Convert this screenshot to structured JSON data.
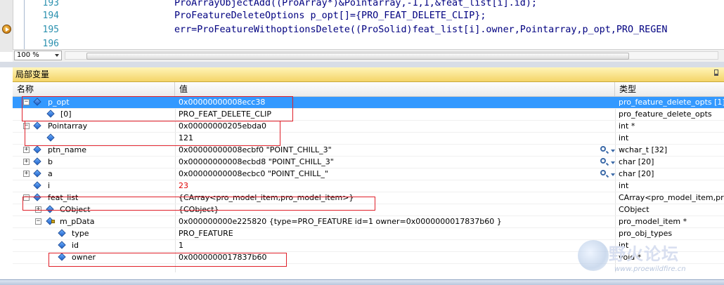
{
  "editor": {
    "lines": [
      {
        "num": "193",
        "code": "ProArrayObjectAdd((ProArray*)&Pointarray,-1,1,&feat_list[i].id);"
      },
      {
        "num": "194",
        "code": "ProFeatureDeleteOptions p_opt[]={PRO_FEAT_DELETE_CLIP};"
      },
      {
        "num": "195",
        "code": "err=ProFeatureWithoptionsDelete((ProSolid)feat_list[i].owner,Pointarray,p_opt,PRO_REGEN"
      },
      {
        "num": "196",
        "code": ""
      }
    ],
    "zoom": "100 %"
  },
  "locals": {
    "title": "局部变量",
    "columns": {
      "name": "名称",
      "value": "值",
      "type": "类型"
    },
    "rows": [
      {
        "name": "p_opt",
        "value": "0x00000000008ecc38",
        "type": "pro_feature_delete_opts [1]"
      },
      {
        "name": "[0]",
        "value": "PRO_FEAT_DELETE_CLIP",
        "type": "pro_feature_delete_opts"
      },
      {
        "name": "Pointarray",
        "value": "0x00000000205ebda0",
        "type": "int *"
      },
      {
        "name": "",
        "value": "121",
        "type": "int"
      },
      {
        "name": "ptn_name",
        "value": "0x00000000008ecbf0 \"POINT_CHILL_3\"",
        "type": "wchar_t [32]"
      },
      {
        "name": "b",
        "value": "0x00000000008ecbd8 \"POINT_CHILL_3\"",
        "type": "char [20]"
      },
      {
        "name": "a",
        "value": "0x00000000008ecbc0 \"POINT_CHILL_\"",
        "type": "char [20]"
      },
      {
        "name": "i",
        "value": "23",
        "type": "int"
      },
      {
        "name": "feat_list",
        "value": "{CArray<pro_model_item,pro_model_item>}",
        "type": "CArray<pro_model_item,pro"
      },
      {
        "name": "CObject",
        "value": "{CObject}",
        "type": "CObject"
      },
      {
        "name": "m_pData",
        "value": "0x000000000e225820 {type=PRO_FEATURE id=1 owner=0x0000000017837b60 }",
        "type": "pro_model_item *"
      },
      {
        "name": "type",
        "value": "PRO_FEATURE",
        "type": "pro_obj_types"
      },
      {
        "name": "id",
        "value": "1",
        "type": "int"
      },
      {
        "name": "owner",
        "value": "0x0000000017837b60",
        "type": "void *"
      }
    ]
  },
  "watermark": {
    "title": "野火论坛",
    "url": "www.proewildfire.cn"
  }
}
